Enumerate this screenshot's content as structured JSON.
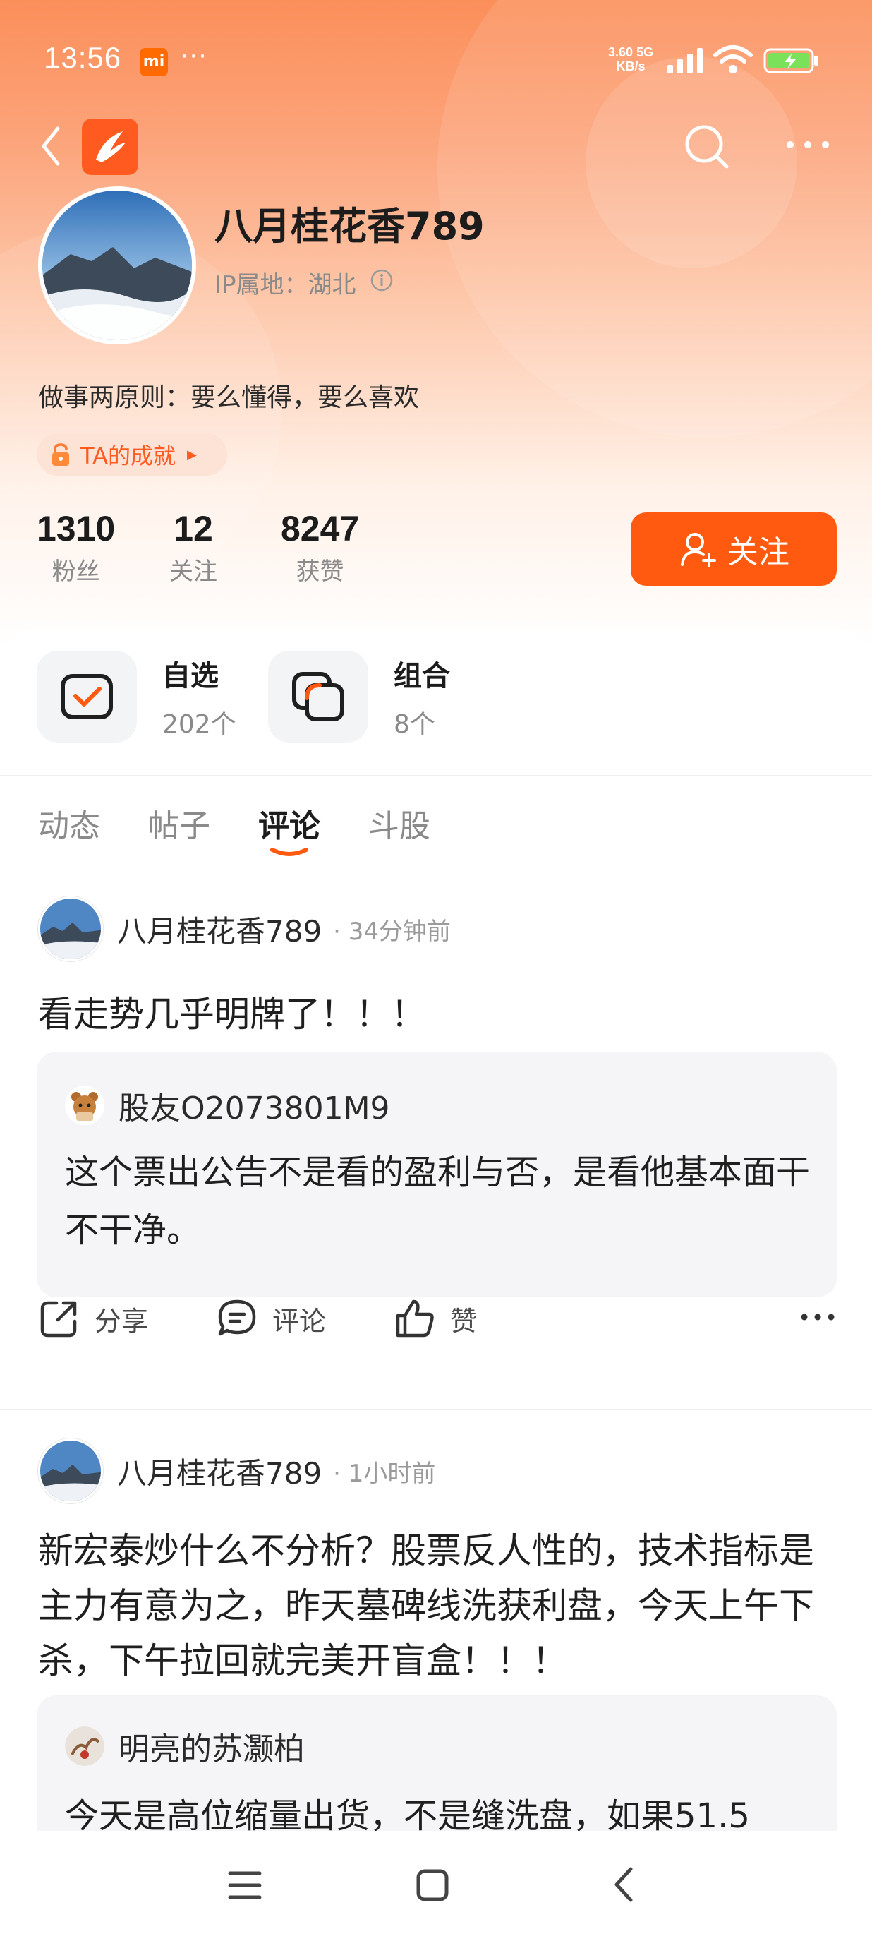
{
  "status_bar": {
    "time": "13:56",
    "app_badge": "mi",
    "more_dots": "···",
    "speed_value": "3.60",
    "speed_unit": "KB/s",
    "network": "5G"
  },
  "profile": {
    "name": "八月桂花香789",
    "ip_location": "IP属地：湖北",
    "bio": "做事两原则：要么懂得，要么喜欢",
    "achievement": "TA的成就",
    "stats": [
      {
        "value": "1310",
        "label": "粉丝"
      },
      {
        "value": "12",
        "label": "关注"
      },
      {
        "value": "8247",
        "label": "获赞"
      }
    ],
    "follow_label": "关注"
  },
  "quick_links": [
    {
      "title": "自选",
      "count": "202个"
    },
    {
      "title": "组合",
      "count": "8个"
    }
  ],
  "tabs": [
    {
      "label": "动态",
      "active": false
    },
    {
      "label": "帖子",
      "active": false
    },
    {
      "label": "评论",
      "active": true
    },
    {
      "label": "斗股",
      "active": false
    }
  ],
  "comments": [
    {
      "user": "八月桂花香789",
      "time": "· 34分钟前",
      "text": "看走势几乎明牌了！！！",
      "quote": {
        "user": "股友O2073801M9",
        "text": "这个票出公告不是看的盈利与否，是看他基本面干不干净。"
      }
    },
    {
      "user": "八月桂花香789",
      "time": "· 1小时前",
      "text": "新宏泰炒什么不分析？股票反人性的，技术指标是主力有意为之，昨天墓碑线洗获利盘，今天上午下杀，下午拉回就完美开盲盒！！！",
      "quote": {
        "user": "明亮的苏灏柏",
        "text": "今天是高位缩量出货，不是缝洗盘，如果51.5"
      }
    }
  ],
  "actions": {
    "share": "分享",
    "comment": "评论",
    "like": "赞"
  },
  "colors": {
    "accent": "#ff5a0f",
    "hero_top": "#fb8f5a",
    "muted_text": "#8a8a8a"
  },
  "icons": [
    "back-icon",
    "app-logo-icon",
    "search-icon",
    "more-icon",
    "info-icon",
    "lock-icon",
    "add-user-icon",
    "watchlist-icon",
    "portfolio-icon",
    "share-icon",
    "comment-icon",
    "like-icon",
    "menu-icon",
    "home-icon",
    "nav-back-icon"
  ]
}
